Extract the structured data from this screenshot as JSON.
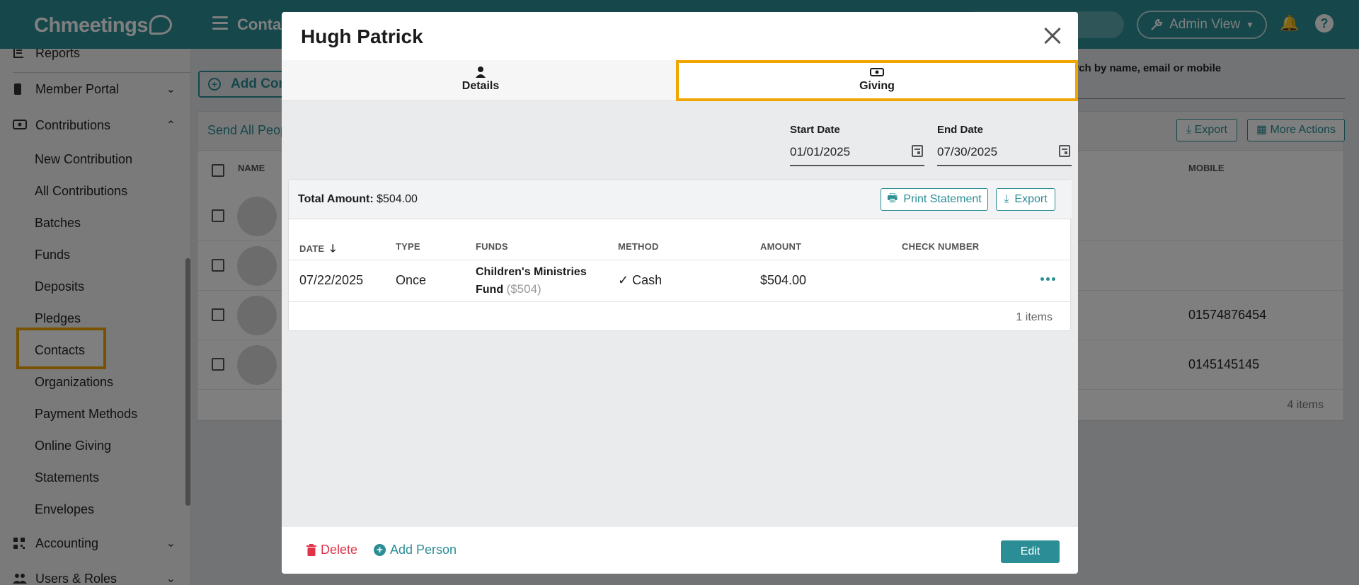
{
  "app": {
    "logo_text": "Chmeetings",
    "top_title": "Contac",
    "admin_view_label": "Admin View",
    "help_label": "?"
  },
  "sidebar": {
    "reports": "Reports",
    "member_portal": "Member Portal",
    "contributions": "Contributions",
    "sub_items": [
      "New Contribution",
      "All Contributions",
      "Batches",
      "Funds",
      "Deposits",
      "Pledges",
      "Contacts",
      "Organizations",
      "Payment Methods",
      "Online Giving",
      "Statements",
      "Envelopes"
    ],
    "accounting": "Accounting",
    "users_roles": "Users & Roles"
  },
  "background": {
    "add_button": "Add Con",
    "send_all": "Send All Peop",
    "col_name": "NAME",
    "col_mobile": "MOBILE",
    "search_hint": "arch by name, email or mobile",
    "export_label": "Export",
    "more_actions_label": "More Actions",
    "mobiles": [
      "",
      "",
      "01574876454",
      "0145145145"
    ],
    "count": "4 items"
  },
  "modal": {
    "title": "Hugh Patrick",
    "tabs": [
      {
        "label": "Details",
        "icon": "person-icon",
        "active": false
      },
      {
        "label": "Giving",
        "icon": "money-icon",
        "active": true
      }
    ],
    "start_date_label": "Start Date",
    "start_date_value": "01/01/2025",
    "end_date_label": "End Date",
    "end_date_value": "07/30/2025",
    "total_label": "Total Amount:",
    "total_value": "$504.00",
    "print_statement": "Print Statement",
    "export": "Export",
    "columns": [
      "DATE",
      "TYPE",
      "FUNDS",
      "METHOD",
      "AMOUNT",
      "CHECK NUMBER"
    ],
    "rows": [
      {
        "date": "07/22/2025",
        "type": "Once",
        "fund_line1": "Children's Ministries",
        "fund_line2": "Fund",
        "fund_amount": "($504)",
        "method": "Cash",
        "amount": "$504.00",
        "check_number": ""
      }
    ],
    "items_count": "1 items",
    "delete": "Delete",
    "add_person": "Add Person",
    "edit": "Edit"
  },
  "colors": {
    "brand": "#2b8e96",
    "highlight": "#f0a500",
    "danger": "#e0334a"
  }
}
